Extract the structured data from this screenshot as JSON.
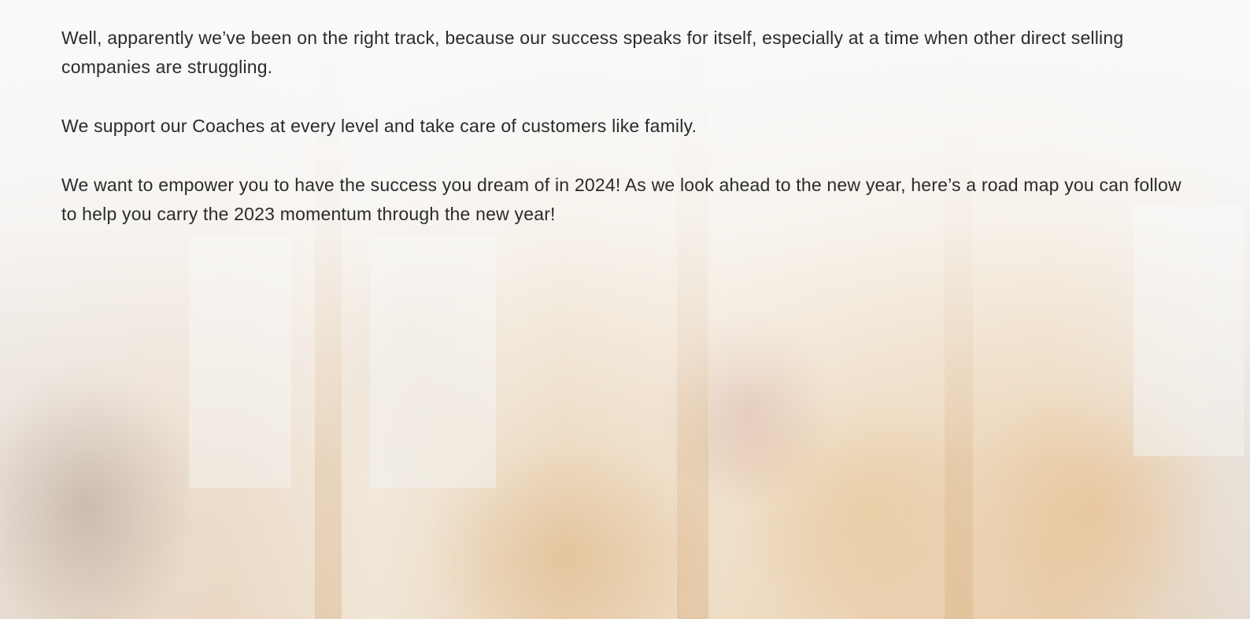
{
  "content": {
    "paragraphs": [
      "Well, apparently we’ve been on the right track, because our success speaks for itself, especially at a time when other direct selling companies are struggling.",
      "We support our Coaches at every level and take care of customers like family.",
      "We want to empower you to have the success you dream of in 2024! As we look ahead to the new year, here’s a road map you can follow to help you carry the 2023 momentum through the new year!"
    ]
  },
  "colors": {
    "text": "#2b2b2b",
    "overlay": "#fafafa",
    "photo_warm": "#e8cfae"
  }
}
